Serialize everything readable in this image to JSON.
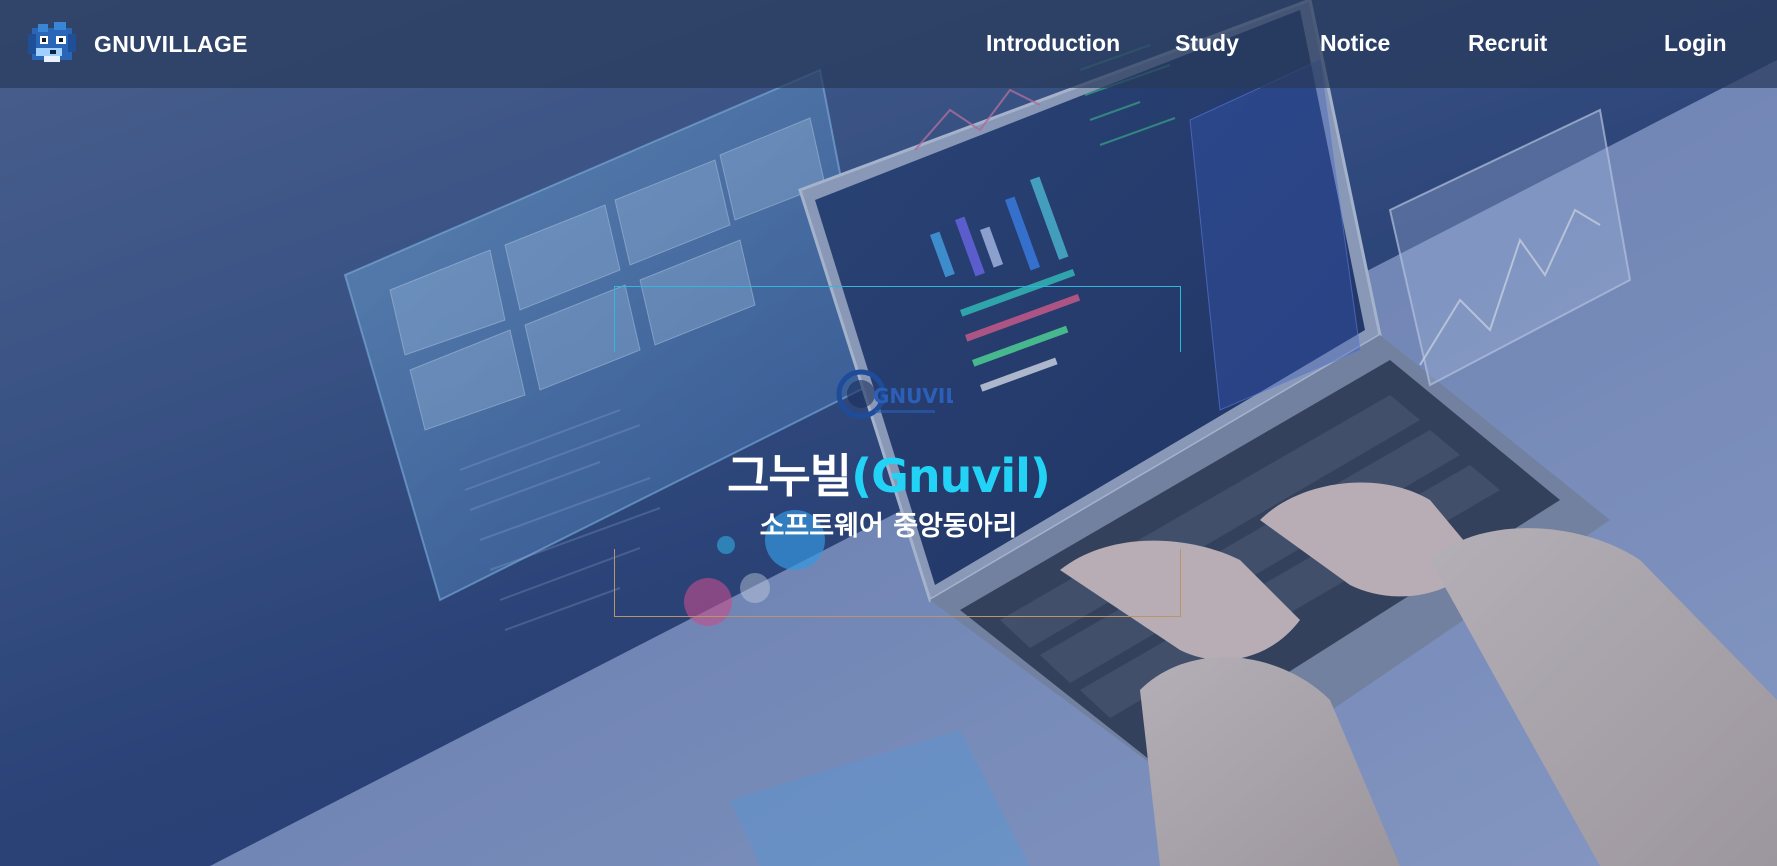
{
  "header": {
    "brand_name": "GNUVILLAGE",
    "brand_logo_icon": "pixel-bird-logo-icon",
    "nav": {
      "introduction": "Introduction",
      "study": "Study",
      "notice": "Notice",
      "recruit": "Recruit",
      "login": "Login"
    }
  },
  "hero": {
    "emblem_icon": "gnuvil-emblem-icon",
    "emblem_text": "GNUVIL",
    "title_korean": "그누빌",
    "title_english": "(Gnuvil)",
    "subtitle": "소프트웨어 중앙동아리"
  },
  "colors": {
    "accent": "#22d3f5",
    "navbar_bg": "#283a5c",
    "frame_top": "#2fb8dc",
    "frame_bottom": "#b8956a"
  }
}
